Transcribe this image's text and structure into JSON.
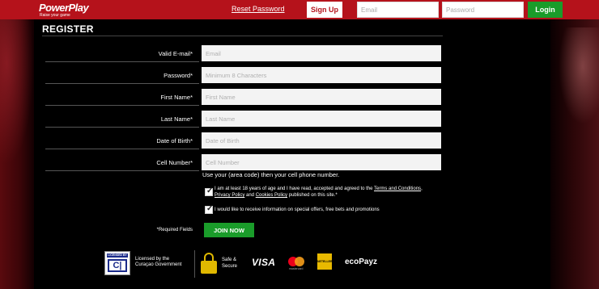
{
  "header": {
    "brand_name": "PowerPlay",
    "brand_tagline": "Raise your game",
    "reset_password_label": "Reset Password",
    "signup_label": "Sign Up",
    "email_placeholder": "Email",
    "password_placeholder": "Password",
    "login_label": "Login"
  },
  "form": {
    "title": "REGISTER",
    "fields": [
      {
        "label": "Valid E-mail*",
        "placeholder": "Email",
        "value": ""
      },
      {
        "label": "Password*",
        "placeholder": "Minimum 8 Characters",
        "value": ""
      },
      {
        "label": "First Name*",
        "placeholder": "First Name",
        "value": ""
      },
      {
        "label": "Last Name*",
        "placeholder": "Last Name",
        "value": ""
      },
      {
        "label": "Date of Birth*",
        "placeholder": "Date of Birth",
        "value": ""
      },
      {
        "label": "Cell Number*",
        "placeholder": "Cell Number",
        "value": ""
      }
    ],
    "cell_hint": "Use your (area code) then your cell phone number.",
    "terms_checkbox": {
      "checked": true,
      "text_before": "I am at least 18 years of age and I have read, accepted and agreed to the ",
      "terms_link": "Terms and Conditions",
      "sep1": ", ",
      "privacy_link": "Privacy Policy",
      "sep2": " and ",
      "cookies_link": "Cookies Policy",
      "text_after": " published on this site.*"
    },
    "offers_checkbox": {
      "checked": true,
      "text": "I would like to receive information on special offers, free bets and promotions"
    },
    "required_note": "*Required Fields",
    "join_label": "JOIN NOW"
  },
  "footer": {
    "license_badge_top": "LICENSED BY",
    "license_badge_mark": "C|",
    "licensed_line1": "Licensed by the",
    "licensed_line2": "Curaçao Government",
    "safe_line1": "Safe &",
    "safe_line2": "Secure",
    "visa": "VISA",
    "mastercard": "mastercard",
    "neteller": "NETELLER",
    "ecopayz": "ecoPayz"
  },
  "colors": {
    "brand_red": "#b5121b",
    "action_green": "#1a9c2a",
    "background": "#000000"
  },
  "icons": {
    "lock": "lock-icon",
    "checkmark": "checkmark-icon"
  }
}
